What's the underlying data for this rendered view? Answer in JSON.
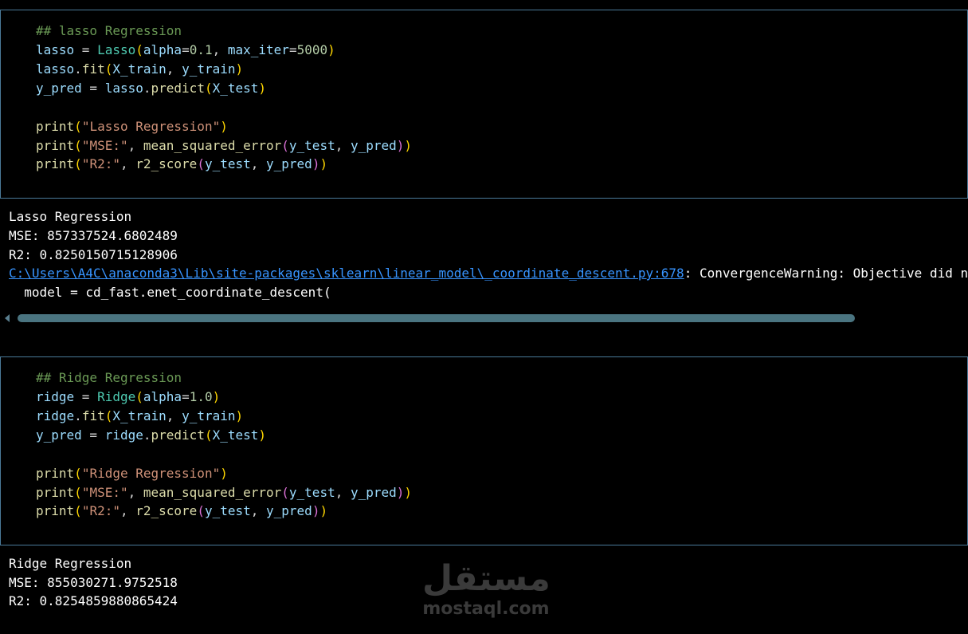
{
  "cell1": {
    "code": {
      "l1": "## lasso Regression",
      "l2_var": "lasso",
      "l2_eq": " = ",
      "l2_cls": "Lasso",
      "l2_p": "(",
      "l2_arg1": "alpha",
      "l2_eq1": "=",
      "l2_n1": "0.1",
      "l2_comma": ", ",
      "l2_arg2": "max_iter",
      "l2_eq2": "=",
      "l2_n2": "5000",
      "l2_pc": ")",
      "l3_var": "lasso",
      "l3_dot": ".",
      "l3_fn": "fit",
      "l3_p": "(",
      "l3_a1": "X_train",
      "l3_comma": ", ",
      "l3_a2": "y_train",
      "l3_pc": ")",
      "l4_var": "y_pred",
      "l4_eq": " = ",
      "l4_obj": "lasso",
      "l4_dot": ".",
      "l4_fn": "predict",
      "l4_p": "(",
      "l4_a1": "X_test",
      "l4_pc": ")",
      "l6_fn": "print",
      "l6_p": "(",
      "l6_str": "\"Lasso Regression\"",
      "l6_pc": ")",
      "l7_fn": "print",
      "l7_p": "(",
      "l7_str": "\"MSE:\"",
      "l7_comma": ", ",
      "l7_fn2": "mean_squared_error",
      "l7_p2": "(",
      "l7_a1": "y_test",
      "l7_comma2": ", ",
      "l7_a2": "y_pred",
      "l7_pc2": ")",
      "l7_pc": ")",
      "l8_fn": "print",
      "l8_p": "(",
      "l8_str": "\"R2:\"",
      "l8_comma": ", ",
      "l8_fn2": "r2_score",
      "l8_p2": "(",
      "l8_a1": "y_test",
      "l8_comma2": ", ",
      "l8_a2": "y_pred",
      "l8_pc2": ")",
      "l8_pc": ")"
    },
    "output": {
      "line1": "Lasso Regression",
      "line2": "MSE: 857337524.6802489",
      "line3": "R2: 0.8250150715128906",
      "warning_path": "C:\\Users\\A4C\\anaconda3\\Lib\\site-packages\\sklearn\\linear_model\\_coordinate_descent.py:678",
      "warning_text": ": ConvergenceWarning: Objective did no",
      "line5": "  model = cd_fast.enet_coordinate_descent("
    }
  },
  "cell2": {
    "code": {
      "l1": "## Ridge Regression",
      "l2_var": "ridge",
      "l2_eq": " = ",
      "l2_cls": "Ridge",
      "l2_p": "(",
      "l2_arg1": "alpha",
      "l2_eq1": "=",
      "l2_n1": "1.0",
      "l2_pc": ")",
      "l3_var": "ridge",
      "l3_dot": ".",
      "l3_fn": "fit",
      "l3_p": "(",
      "l3_a1": "X_train",
      "l3_comma": ", ",
      "l3_a2": "y_train",
      "l3_pc": ")",
      "l4_var": "y_pred",
      "l4_eq": " = ",
      "l4_obj": "ridge",
      "l4_dot": ".",
      "l4_fn": "predict",
      "l4_p": "(",
      "l4_a1": "X_test",
      "l4_pc": ")",
      "l6_fn": "print",
      "l6_p": "(",
      "l6_str": "\"Ridge Regression\"",
      "l6_pc": ")",
      "l7_fn": "print",
      "l7_p": "(",
      "l7_str": "\"MSE:\"",
      "l7_comma": ", ",
      "l7_fn2": "mean_squared_error",
      "l7_p2": "(",
      "l7_a1": "y_test",
      "l7_comma2": ", ",
      "l7_a2": "y_pred",
      "l7_pc2": ")",
      "l7_pc": ")",
      "l8_fn": "print",
      "l8_p": "(",
      "l8_str": "\"R2:\"",
      "l8_comma": ", ",
      "l8_fn2": "r2_score",
      "l8_p2": "(",
      "l8_a1": "y_test",
      "l8_comma2": ", ",
      "l8_a2": "y_pred",
      "l8_pc2": ")",
      "l8_pc": ")"
    },
    "output": {
      "line1": "Ridge Regression",
      "line2": "MSE: 855030271.9752518",
      "line3": "R2: 0.8254859880865424"
    }
  },
  "watermark": {
    "arabic": "مستقل",
    "latin": "mostaql.com"
  },
  "colors": {
    "background": "#000000",
    "cell_border": "#4a7a99",
    "comment": "#6a9955",
    "variable": "#9cdcfe",
    "class": "#4ec9b0",
    "function": "#dcdcaa",
    "number": "#b5cea8",
    "string": "#ce9178",
    "link": "#3794ff"
  }
}
